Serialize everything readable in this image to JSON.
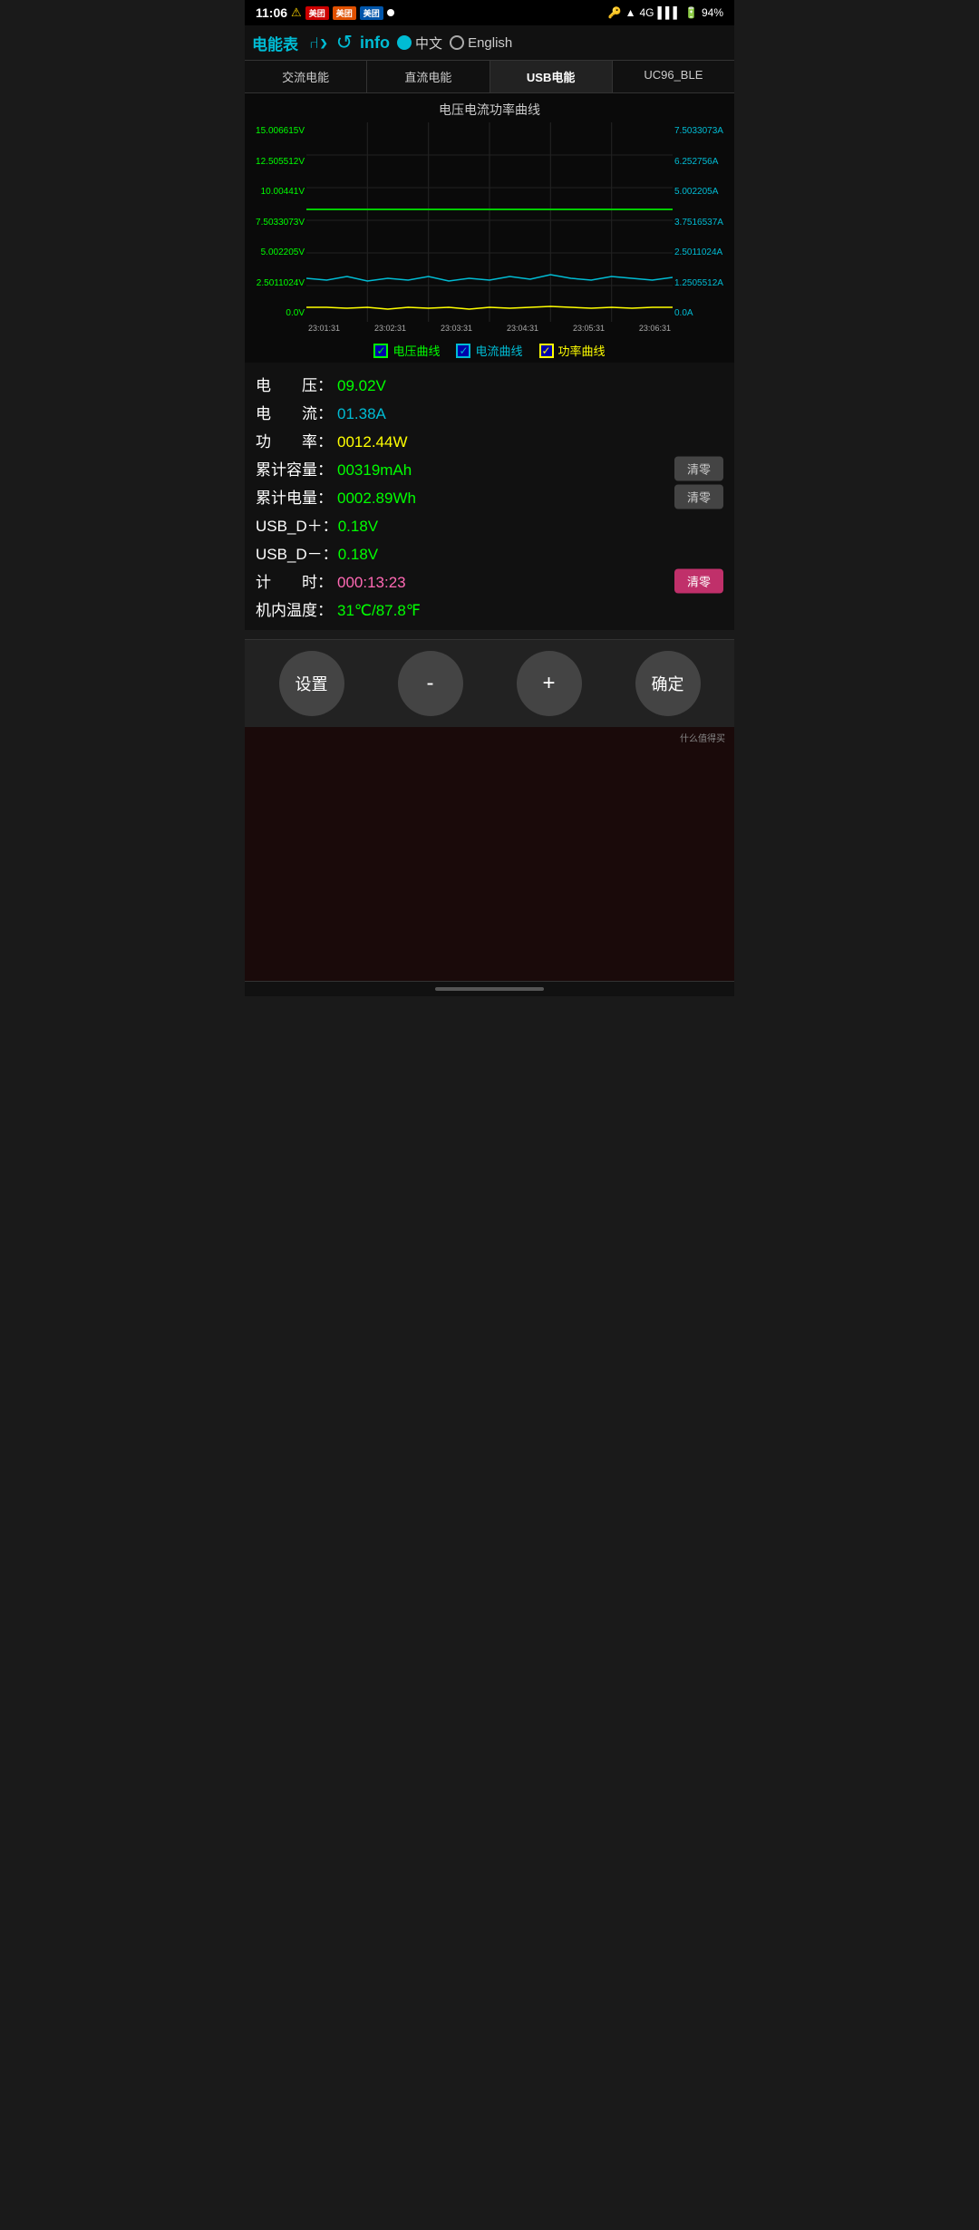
{
  "statusBar": {
    "time": "11:06",
    "batteryPercent": "94%",
    "network": "4G"
  },
  "header": {
    "title": "电能表",
    "infoLabel": "info",
    "langCn": "中文",
    "langEn": "English",
    "selectedLang": "cn"
  },
  "tabs": [
    {
      "id": "ac",
      "label": "交流电能",
      "active": false
    },
    {
      "id": "dc",
      "label": "直流电能",
      "active": false
    },
    {
      "id": "usb",
      "label": "USB电能",
      "active": true
    },
    {
      "id": "ble",
      "label": "UC96_BLE",
      "active": false
    }
  ],
  "chart": {
    "title": "电压电流功率曲线",
    "yLeftLabels": [
      "15.006615V",
      "12.505512V",
      "10.00441V",
      "7.5033073V",
      "5.002205V",
      "2.5011024V",
      "0.0V"
    ],
    "yRightLabels": [
      "7.5033073A",
      "6.252756A",
      "5.002205A",
      "3.7516537A",
      "2.5011024A",
      "1.2505512A",
      "0.0A"
    ],
    "xLabels": [
      "23:01:31",
      "23:02:31",
      "23:03:31",
      "23:04:31",
      "23:05:31",
      "23:06:31"
    ]
  },
  "legend": {
    "voltageLabel": "电压曲线",
    "currentLabel": "电流曲线",
    "powerLabel": "功率曲线"
  },
  "data": {
    "voltageLabel": "电　　压：",
    "voltageValue": "09.02V",
    "currentLabel": "电　　流：",
    "currentValue": "01.38A",
    "powerLabel": "功　　率：",
    "powerValue": "0012.44W",
    "capacityLabel": "累计容量：",
    "capacityValue": "00319mAh",
    "energyLabel": "累计电量：",
    "energyValue": "0002.89Wh",
    "usbDPlusLabel": "USB_D＋：",
    "usbDPlusValue": "0.18V",
    "usbDMinusLabel": "USB_D－：",
    "usbDMinusValue": "0.18V",
    "timeLabel": "计　　时：",
    "timeValue": "000:13:23",
    "tempLabel": "机内温度：",
    "tempValue": "31℃/87.8℉",
    "clearLabel": "清零",
    "clearLabel2": "清零",
    "clearLabel3": "清零"
  },
  "bottomBar": {
    "settingsLabel": "设置",
    "minusLabel": "-",
    "plusLabel": "+",
    "confirmLabel": "确定"
  },
  "watermark": "什么值得买"
}
